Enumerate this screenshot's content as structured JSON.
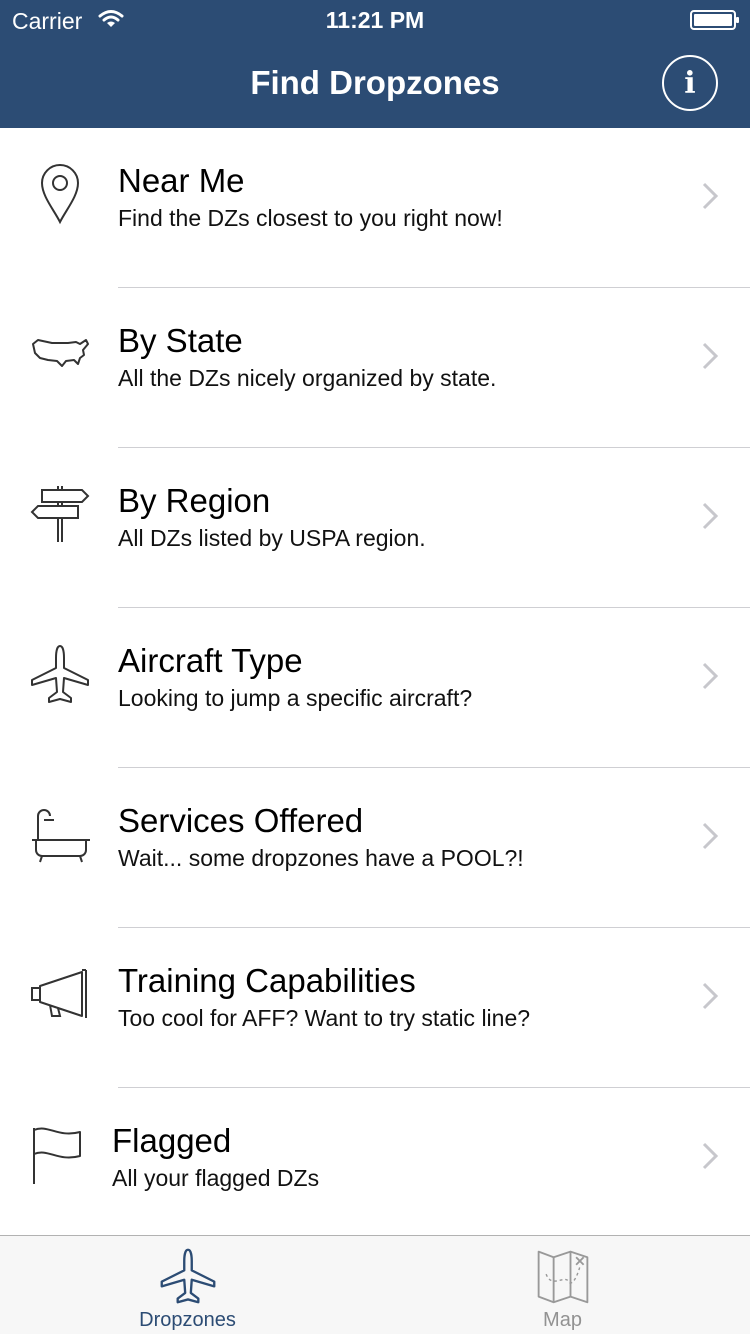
{
  "status_bar": {
    "carrier": "Carrier",
    "time": "11:21 PM"
  },
  "nav": {
    "title": "Find Dropzones",
    "info_glyph": "i"
  },
  "colors": {
    "nav_background": "#2c4c74",
    "tab_active": "#2c4c74",
    "tab_inactive": "#929292"
  },
  "rows": [
    {
      "icon": "location-pin-icon",
      "title": "Near Me",
      "subtitle": "Find the DZs closest to you right now!"
    },
    {
      "icon": "usa-map-icon",
      "title": "By State",
      "subtitle": "All the DZs nicely organized by state."
    },
    {
      "icon": "signpost-icon",
      "title": "By Region",
      "subtitle": "All DZs listed by USPA region."
    },
    {
      "icon": "airplane-icon",
      "title": "Aircraft Type",
      "subtitle": "Looking to jump a specific aircraft?"
    },
    {
      "icon": "bathtub-icon",
      "title": "Services Offered",
      "subtitle": "Wait... some dropzones have a POOL?!"
    },
    {
      "icon": "megaphone-icon",
      "title": "Training Capabilities",
      "subtitle": "Too cool for AFF? Want to try static line?"
    },
    {
      "icon": "flag-icon",
      "title": "Flagged",
      "subtitle": "All your flagged DZs"
    }
  ],
  "tabs": [
    {
      "icon": "airplane-icon",
      "label": "Dropzones",
      "active": true
    },
    {
      "icon": "treasure-map-icon",
      "label": "Map",
      "active": false
    }
  ]
}
